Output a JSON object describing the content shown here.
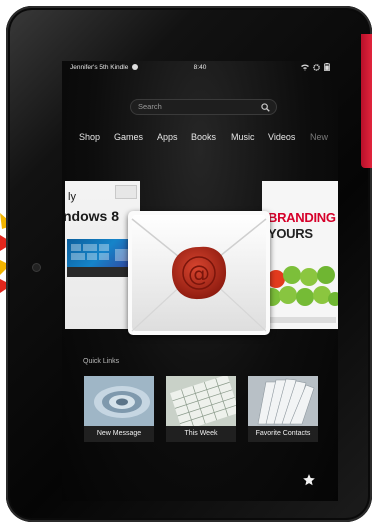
{
  "status_bar": {
    "device_name": "Jennifer's 5th Kindle",
    "time": "8:40"
  },
  "search": {
    "placeholder": "Search"
  },
  "nav": {
    "items": [
      "Shop",
      "Games",
      "Apps",
      "Books",
      "Music",
      "Videos",
      "New"
    ]
  },
  "carousel": {
    "left_card": {
      "title_line1": "ly",
      "title_line2": "ndows 8"
    },
    "right_card": {
      "title_line1": "BRANDING",
      "title_line2": "YOURS"
    },
    "center_icon": "email-envelope-icon"
  },
  "quick_links": {
    "label": "Quick Links",
    "items": [
      {
        "label": "New Message",
        "icon": "spiral-thumbnail"
      },
      {
        "label": "This Week",
        "icon": "calendar-thumbnail"
      },
      {
        "label": "Favorite Contacts",
        "icon": "rolodex-thumbnail"
      }
    ]
  },
  "colors": {
    "accent_red": "#d6002a",
    "device_edge_red": "#e2243c",
    "wax_seal": "#b52b1c"
  }
}
